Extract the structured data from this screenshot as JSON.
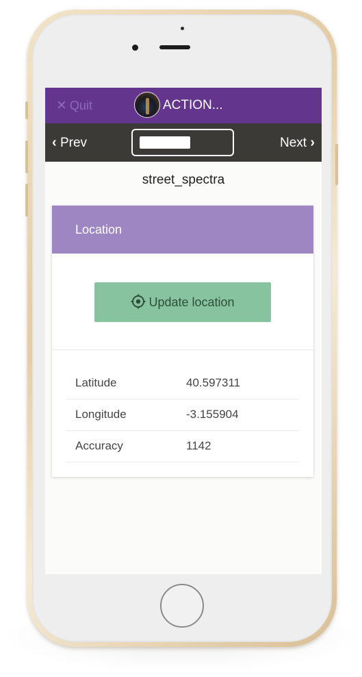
{
  "header": {
    "quit_label": "Quit",
    "title": "ACTION..."
  },
  "nav": {
    "prev_label": "Prev",
    "next_label": "Next"
  },
  "page": {
    "subtitle": "street_spectra"
  },
  "location_card": {
    "title": "Location",
    "update_button_label": "Update location",
    "rows": [
      {
        "label": "Latitude",
        "value": "40.597311"
      },
      {
        "label": "Longitude",
        "value": "-3.155904"
      },
      {
        "label": "Accuracy",
        "value": "1142"
      }
    ]
  },
  "icons": {
    "quit": "close-icon",
    "prev": "chevron-left-icon",
    "next": "chevron-right-icon",
    "update": "location-target-icon"
  },
  "colors": {
    "header_bg": "#63358d",
    "nav_bg": "#3b3a37",
    "card_header_bg": "#9d86c2",
    "button_bg": "#88c3a0"
  }
}
